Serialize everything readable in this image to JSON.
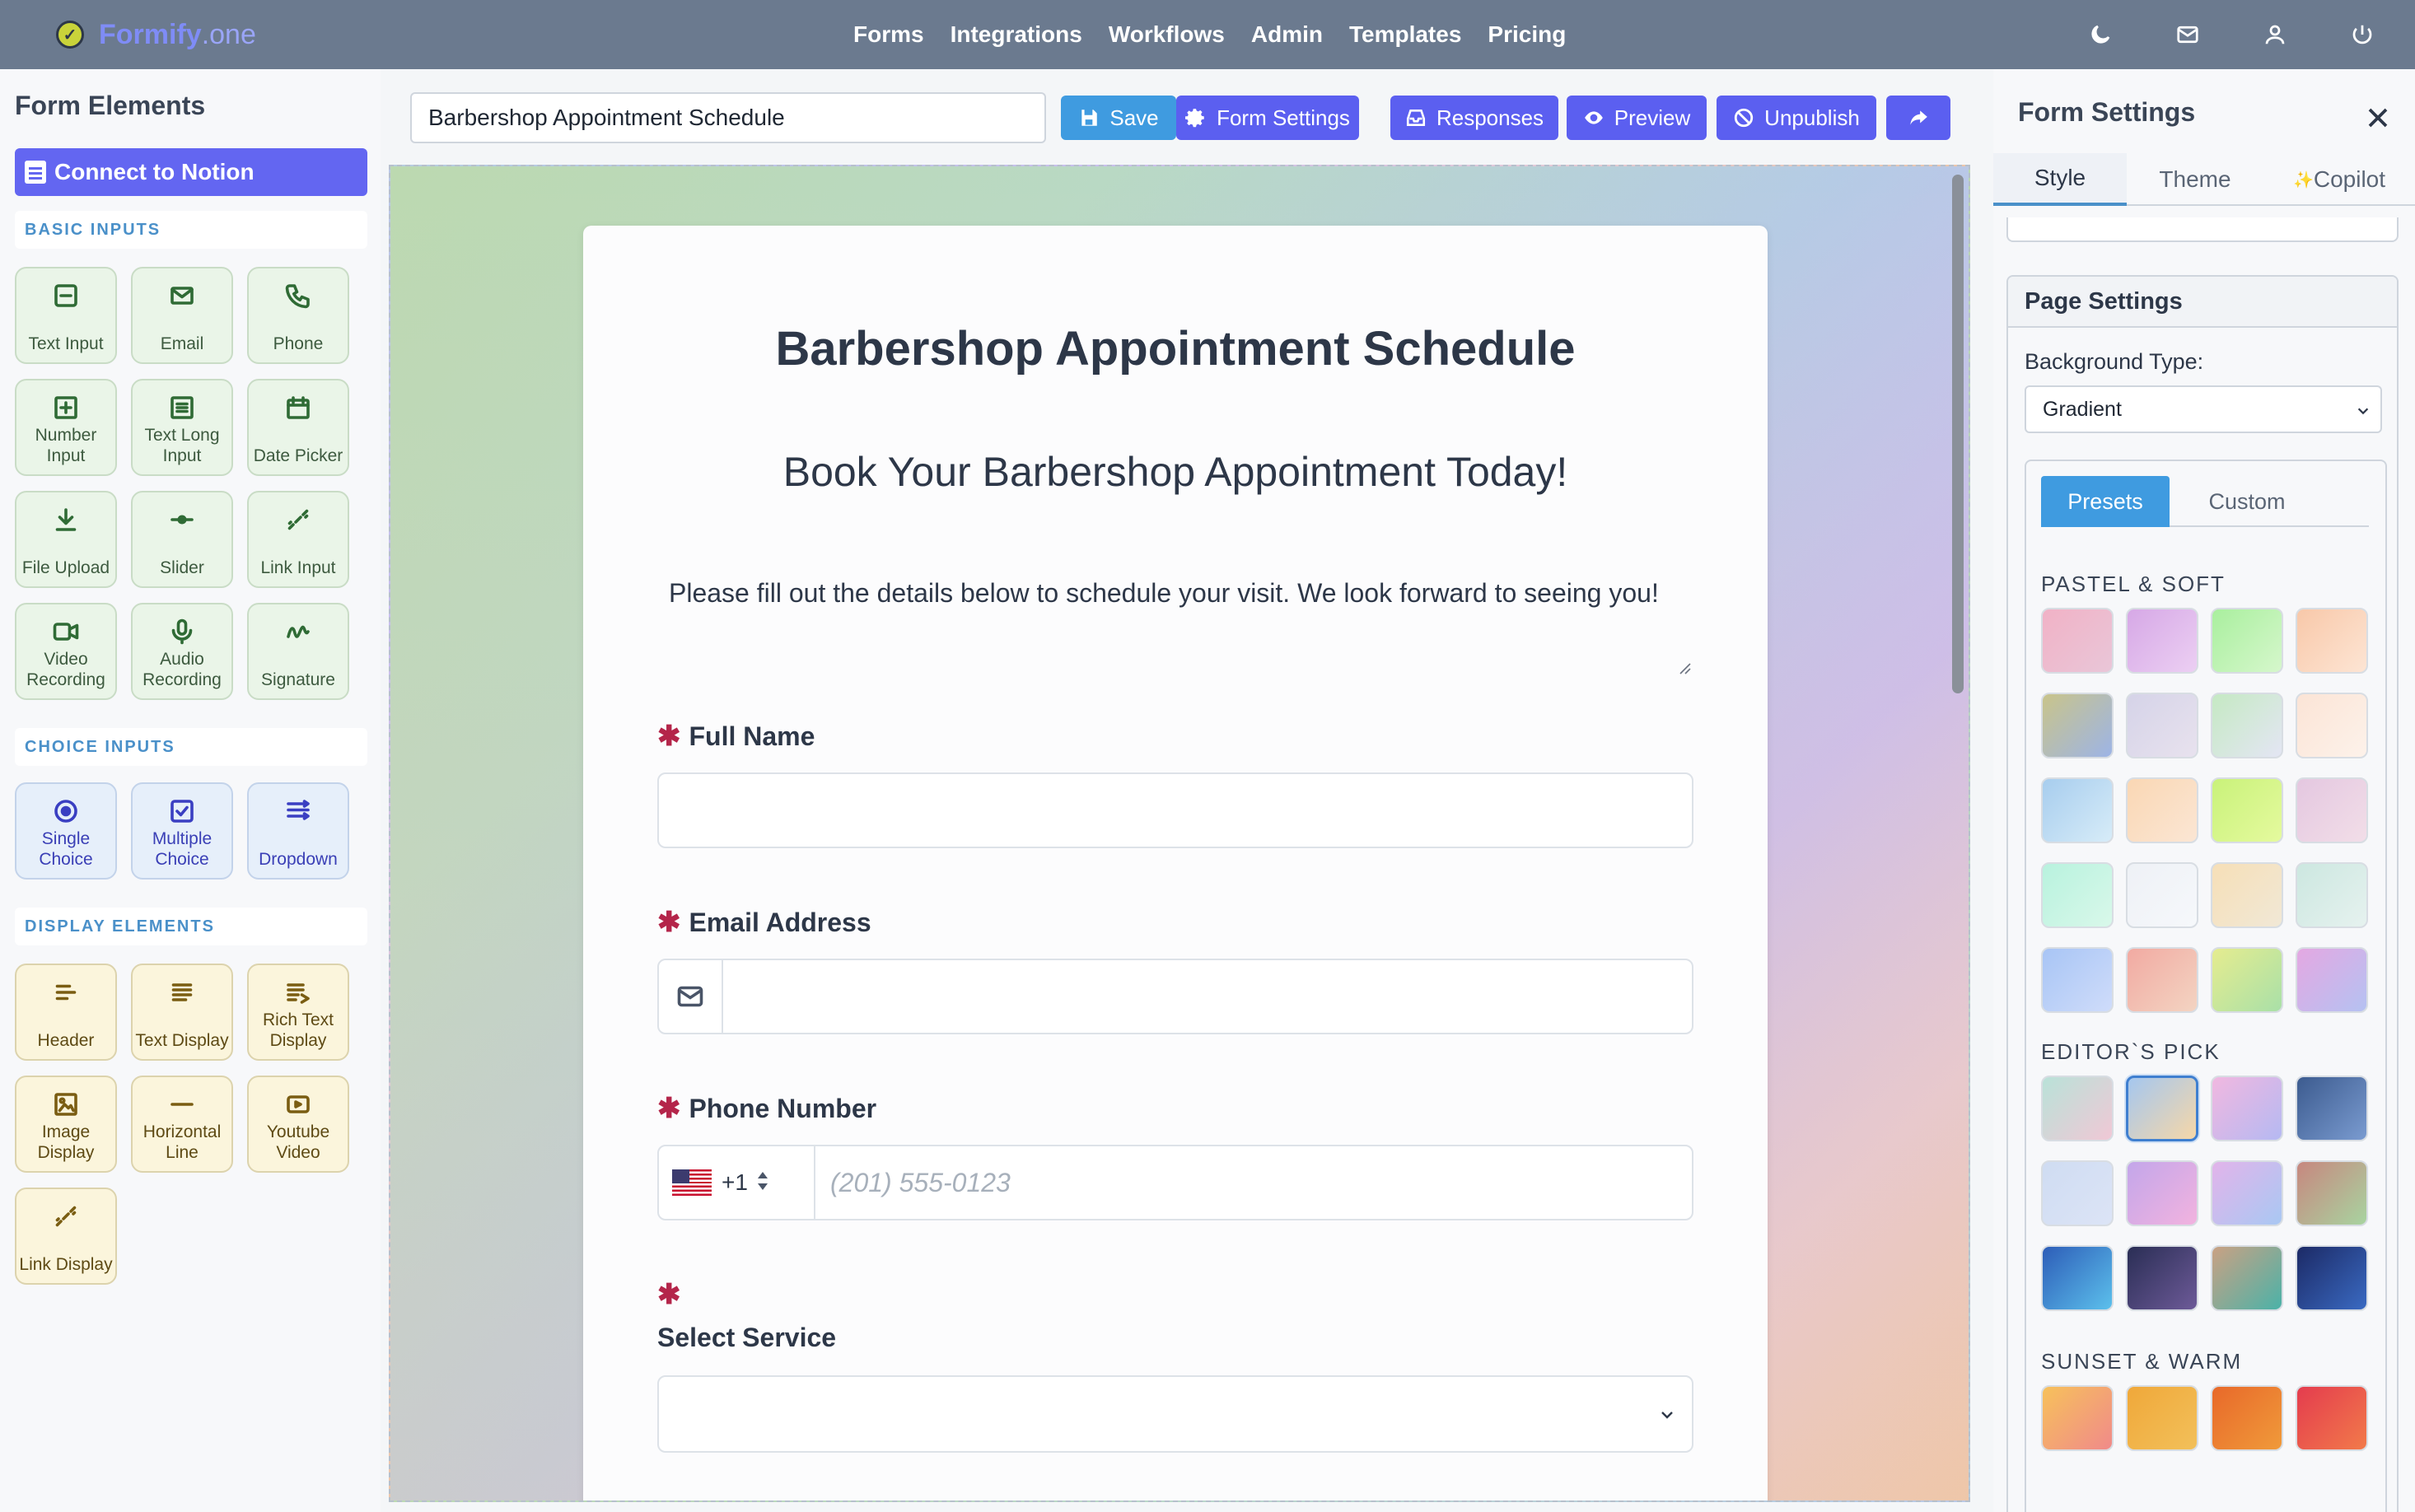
{
  "app": {
    "brand_name": "Formify",
    "brand_suffix": ".one",
    "nav": [
      "Forms",
      "Integrations",
      "Workflows",
      "Admin",
      "Templates",
      "Pricing"
    ],
    "nav_icons": [
      "moon-icon",
      "mail-icon",
      "user-icon",
      "power-icon"
    ]
  },
  "sidebar": {
    "title": "Form Elements",
    "notion_button": "Connect to Notion",
    "sections": [
      {
        "title": "BASIC INPUTS",
        "color": "green",
        "items": [
          {
            "label": "Text Input",
            "icon": "text-input-icon"
          },
          {
            "label": "Email",
            "icon": "email-icon"
          },
          {
            "label": "Phone",
            "icon": "phone-icon"
          },
          {
            "label": "Number Input",
            "icon": "number-icon"
          },
          {
            "label": "Text Long Input",
            "icon": "long-text-icon"
          },
          {
            "label": "Date Picker",
            "icon": "calendar-icon"
          },
          {
            "label": "File Upload",
            "icon": "upload-icon"
          },
          {
            "label": "Slider",
            "icon": "slider-icon"
          },
          {
            "label": "Link Input",
            "icon": "link-icon"
          },
          {
            "label": "Video Recording",
            "icon": "video-icon"
          },
          {
            "label": "Audio Recording",
            "icon": "mic-icon"
          },
          {
            "label": "Signature",
            "icon": "signature-icon"
          }
        ]
      },
      {
        "title": "CHOICE INPUTS",
        "color": "blue",
        "items": [
          {
            "label": "Single Choice",
            "icon": "radio-icon"
          },
          {
            "label": "Multiple Choice",
            "icon": "checkbox-icon"
          },
          {
            "label": "Dropdown",
            "icon": "dropdown-icon"
          }
        ]
      },
      {
        "title": "DISPLAY ELEMENTS",
        "color": "yellow",
        "items": [
          {
            "label": "Header",
            "icon": "header-icon"
          },
          {
            "label": "Text Display",
            "icon": "text-display-icon"
          },
          {
            "label": "Rich Text Display",
            "icon": "rich-text-icon"
          },
          {
            "label": "Image Display",
            "icon": "image-icon"
          },
          {
            "label": "Horizontal Line",
            "icon": "hline-icon"
          },
          {
            "label": "Youtube Video",
            "icon": "youtube-icon"
          },
          {
            "label": "Link Display",
            "icon": "link-display-icon"
          }
        ]
      }
    ]
  },
  "toolbar": {
    "form_name": "Barbershop Appointment Schedule",
    "save": "Save",
    "form_settings": "Form Settings",
    "responses": "Responses",
    "preview": "Preview",
    "unpublish": "Unpublish"
  },
  "form": {
    "title": "Barbershop Appointment Schedule",
    "subtitle": "Book Your Barbershop Appointment Today!",
    "description": "Please fill out the details below to schedule your visit. We look forward to seeing you!",
    "required_mark": "✱",
    "fields": {
      "full_name": "Full Name",
      "email": "Email Address",
      "phone": "Phone Number",
      "phone_code": "+1",
      "phone_placeholder": "(201) 555-0123",
      "service": "Select Service"
    }
  },
  "right_panel": {
    "title": "Form Settings",
    "tabs": [
      "Style",
      "Theme",
      "Copilot"
    ],
    "copilot_glyph": "✨",
    "page_settings": "Page Settings",
    "background_type_label": "Background Type:",
    "background_type_value": "Gradient",
    "segments": [
      "Presets",
      "Custom"
    ],
    "groups": [
      {
        "title": "PASTEL & SOFT",
        "swatches": [
          [
            "#f1b2c6",
            "#e9c6d8"
          ],
          [
            "#d6a8e6",
            "#eccff3"
          ],
          [
            "#a9ef9e",
            "#d6f7cc"
          ],
          [
            "#f8c8a9",
            "#fde5d4"
          ],
          [
            "#c9c48a",
            "#9db4e6"
          ],
          [
            "#d5d3e8",
            "#e8e2ee"
          ],
          [
            "#c5e9c3",
            "#e4e6f4"
          ],
          [
            "#fbe4d6",
            "#fdf2ea"
          ],
          [
            "#a7cdee",
            "#d7ecf8"
          ],
          [
            "#fad7b4",
            "#fbe6d4"
          ],
          [
            "#c9f27a",
            "#e5fa9e"
          ],
          [
            "#e4c7e0",
            "#f2dee8"
          ],
          [
            "#b8f2de",
            "#d9f8ea"
          ],
          [
            "#eef1f6",
            "#f6f8fb"
          ],
          [
            "#f6dfb7",
            "#f1e8d6"
          ],
          [
            "#cce7e0",
            "#e6f2ef"
          ],
          [
            "#a8c5f5",
            "#cfdcfa"
          ],
          [
            "#f2aaa2",
            "#f3d4c2"
          ],
          [
            "#e5ec8f",
            "#a9e0a8"
          ],
          [
            "#e4a8e2",
            "#b5c2f2"
          ]
        ]
      },
      {
        "title": "EDITOR`S PICK",
        "swatches": [
          [
            "#b9e2d8",
            "#f0c8d6"
          ],
          [
            "#a5c7ef",
            "#f6d7a8"
          ],
          [
            "#f1b8e0",
            "#b5b9f2"
          ],
          [
            "#3c5b8f",
            "#7a9bd0"
          ],
          [
            "#cfdcf2",
            "#dce4f6"
          ],
          [
            "#c3a6ea",
            "#f2b3df"
          ],
          [
            "#e2b4ea",
            "#a9c8f3"
          ],
          [
            "#c7877f",
            "#a8d4a0"
          ],
          [
            "#2d5db8",
            "#5cc0ec"
          ],
          [
            "#2a2e55",
            "#6d5a98"
          ],
          [
            "#caa183",
            "#4bb2a8"
          ],
          [
            "#1c2a66",
            "#3a6ac2"
          ]
        ]
      },
      {
        "title": "SUNSET & WARM",
        "swatches": [
          [
            "#f7c15b",
            "#f08a8a"
          ],
          [
            "#f0a83a",
            "#f2c05a"
          ],
          [
            "#e8692a",
            "#f09a3a"
          ],
          [
            "#e43c4e",
            "#f27a4a"
          ]
        ]
      }
    ]
  }
}
